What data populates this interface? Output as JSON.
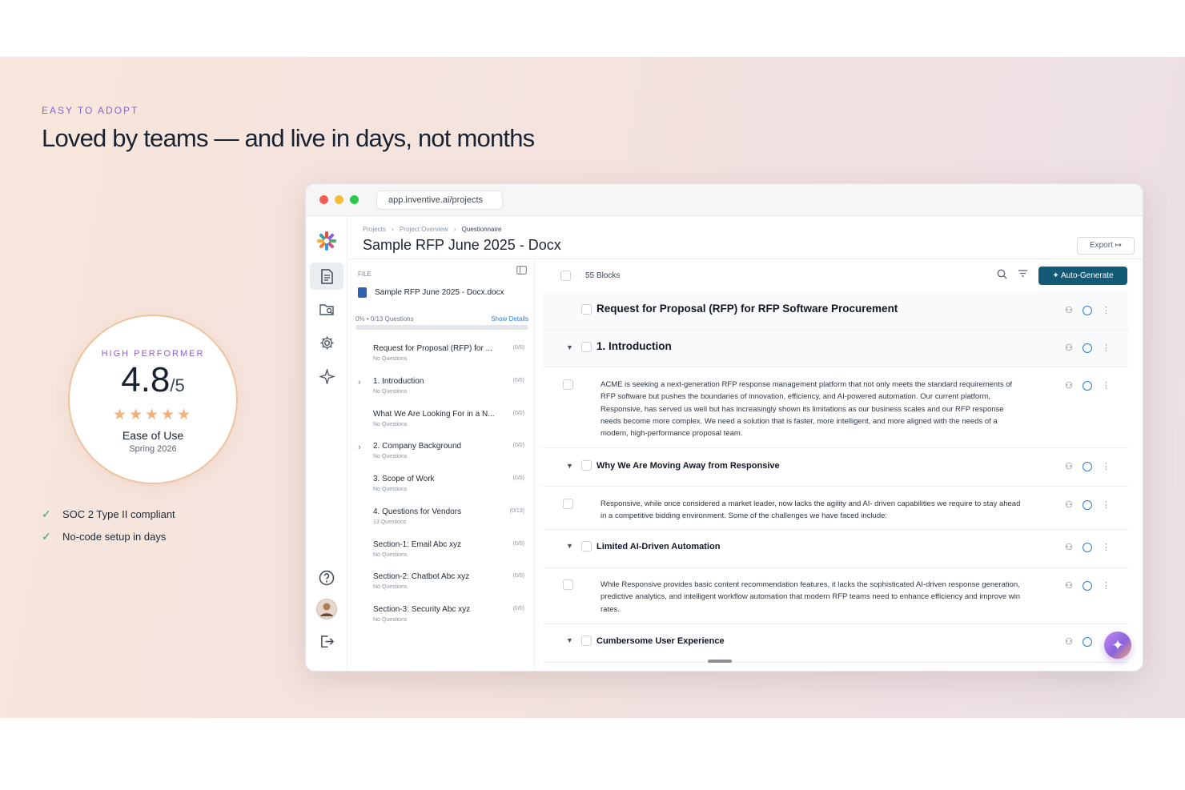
{
  "hero": {
    "eyebrow": "EASY TO ADOPT",
    "headline": "Loved by teams — and live in days, not months"
  },
  "badge": {
    "label": "HIGH PERFORMER",
    "score": "4.8",
    "scale": "/5",
    "stars": "★★★★★",
    "category": "Ease of Use",
    "season": "Spring 2026"
  },
  "checks": [
    {
      "tick": "✓",
      "text": "SOC 2 Type II compliant"
    },
    {
      "tick": "✓",
      "text": "No-code setup in days"
    }
  ],
  "colors": {
    "accent": "#8b5fd6",
    "primary_button": "#135a77",
    "check": "#3aa76d",
    "star": "#f0b27d"
  },
  "browser": {
    "url": "app.inventive.ai/projects"
  },
  "app": {
    "breadcrumbs": {
      "one": "Projects",
      "two": "Project Overview",
      "three": "Questionnaire",
      "sep": "›"
    },
    "title": "Sample RFP June 2025 - Docx",
    "export_label": "Export",
    "rail_icons": [
      "document-icon",
      "folder-search-icon",
      "gear-icon",
      "sparkle-icon",
      "help-icon",
      "avatar",
      "logout-icon"
    ],
    "file_panel": {
      "label": "FILE",
      "file_name": "Sample RFP June 2025 - Docx.docx",
      "progress": "0% • 0/13 Questions",
      "progress_value": 0,
      "show_details": "Show Details",
      "items": [
        {
          "name": "Request for Proposal (RFP) for ...",
          "count": "(0/0)",
          "sub": "No Questions",
          "chev": ""
        },
        {
          "name": "1. Introduction",
          "count": "(0/0)",
          "sub": "No Questions",
          "chev": "›"
        },
        {
          "name": "What We Are Looking For in a N...",
          "count": "(0/0)",
          "sub": "No Questions",
          "chev": ""
        },
        {
          "name": "2. Company Background",
          "count": "(0/0)",
          "sub": "No Questions",
          "chev": "›"
        },
        {
          "name": "3. Scope of Work",
          "count": "(0/0)",
          "sub": "No Questions",
          "chev": ""
        },
        {
          "name": "4. Questions for Vendors",
          "count": "(0/13)",
          "sub": "13 Questions",
          "chev": ""
        },
        {
          "name": "Section-1: Email Abc xyz",
          "count": "(0/0)",
          "sub": "No Questions",
          "chev": ""
        },
        {
          "name": "Section-2: Chatbot Abc xyz",
          "count": "(0/0)",
          "sub": "No Questions",
          "chev": ""
        },
        {
          "name": "Section-3: Security Abc xyz",
          "count": "(0/0)",
          "sub": "No Questions",
          "chev": ""
        }
      ]
    },
    "toolbar": {
      "blocks_count": "55 Blocks",
      "auto_generate": "✦  Auto-Generate"
    },
    "blocks": [
      {
        "kind": "title",
        "title": "Request for Proposal (RFP) for RFP Software Procurement"
      },
      {
        "kind": "heading",
        "title": "1. Introduction"
      },
      {
        "kind": "text",
        "text": "ACME is seeking a next-generation RFP response management platform that not only meets the standard requirements of RFP software but pushes the boundaries of innovation, efficiency, and AI-powered automation. Our current platform, Responsive, has served us well but has increasingly shown its limitations as our business scales and our RFP response needs become more complex. We need a solution that is faster, more intelligent, and more aligned with the needs of a modern, high-performance proposal team."
      },
      {
        "kind": "subheading",
        "title": "Why We Are Moving Away from Responsive"
      },
      {
        "kind": "text",
        "text": "Responsive, while once considered a market leader, now lacks the agility and AI- driven capabilities we require to stay ahead in a competitive bidding environment. Some of the challenges we have faced include:"
      },
      {
        "kind": "subheading",
        "title": "Limited AI-Driven Automation"
      },
      {
        "kind": "text",
        "text": "While Responsive provides basic content recommendation features, it lacks the sophisticated AI-driven response generation, predictive analytics, and intelligent workflow automation that modern RFP teams need to enhance efficiency and improve win rates."
      },
      {
        "kind": "subheading",
        "title": "Cumbersome User Experience"
      }
    ],
    "fab_icon": "✦"
  }
}
